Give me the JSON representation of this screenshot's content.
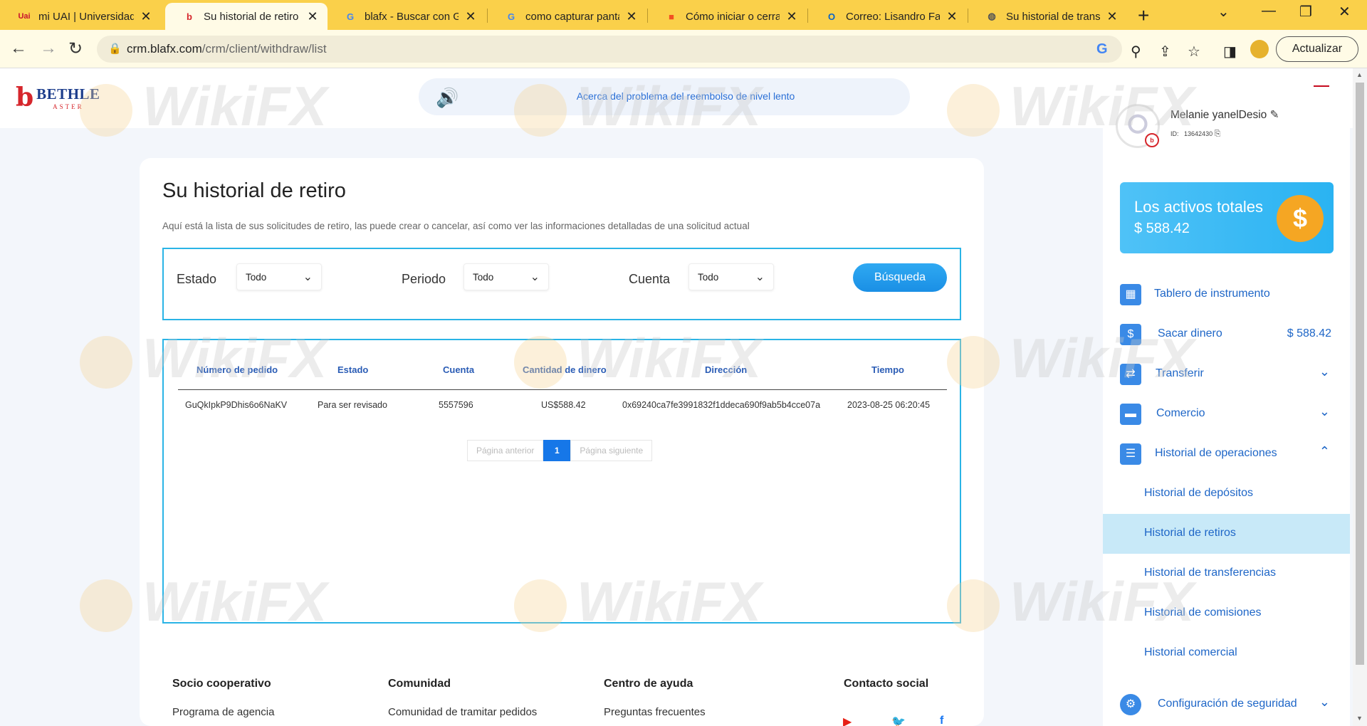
{
  "browser": {
    "tabs": [
      {
        "title": "mi UAI | Universidad A",
        "favicon": "Uai",
        "favicon_color": "#c8102e"
      },
      {
        "title": "Su historial de retiro",
        "favicon": "b",
        "favicon_color": "#d6262c",
        "active": true
      },
      {
        "title": "blafx - Buscar con Goo",
        "favicon": "G",
        "favicon_color": "#4285f4"
      },
      {
        "title": "como capturar pantal",
        "favicon": "G",
        "favicon_color": "#4285f4"
      },
      {
        "title": "Cómo iniciar o cerrar",
        "favicon": "■",
        "favicon_color": "#f25022"
      },
      {
        "title": "Correo: Lisandro Farir",
        "favicon": "O",
        "favicon_color": "#0a64c8"
      },
      {
        "title": "Su historial de transfe",
        "favicon": "◍",
        "favicon_color": "#555"
      }
    ],
    "url_host": "crm.blafx.com",
    "url_path": "/crm/client/withdraw/list",
    "update_label": "Actualizar"
  },
  "header": {
    "logo_main": "BETHLE",
    "logo_sub": "ASTER",
    "notice": "Acerca del problema del reembolso de nivel lento"
  },
  "main": {
    "title": "Su historial de retiro",
    "description": "Aquí está la lista de sus solicitudes de retiro, las puede crear o cancelar, así como ver las informaciones detalladas de una solicitud actual",
    "filters": {
      "estado_label": "Estado",
      "estado_value": "Todo",
      "periodo_label": "Periodo",
      "periodo_value": "Todo",
      "cuenta_label": "Cuenta",
      "cuenta_value": "Todo",
      "search_label": "Búsqueda"
    },
    "table": {
      "headers": [
        "Número de pedido",
        "Estado",
        "Cuenta",
        "Cantidad de dinero",
        "Dirección",
        "Tiempo"
      ],
      "rows": [
        [
          "GuQkIpkP9Dhis6o6NaKV",
          "Para ser revisado",
          "5557596",
          "US$588.42",
          "0x69240ca7fe3991832f1ddeca690f9ab5b4cce07a",
          "2023-08-25 06:20:45"
        ]
      ]
    },
    "pager": {
      "prev": "Página anterior",
      "current": "1",
      "next": "Página siguiente"
    }
  },
  "footer": {
    "cols": [
      {
        "heading": "Socio cooperativo",
        "link": "Programa de agencia"
      },
      {
        "heading": "Comunidad",
        "link": "Comunidad de tramitar pedidos"
      },
      {
        "heading": "Centro de ayuda",
        "link": "Preguntas frecuentes"
      },
      {
        "heading": "Contacto social",
        "link": ""
      }
    ]
  },
  "sidebar": {
    "user_name": "Melanie yanelDesio",
    "user_id_label": "ID:",
    "user_id": "13642430",
    "assets_title": "Los activos totales",
    "assets_amount": "$ 588.42",
    "nav": {
      "dashboard": "Tablero de instrumento",
      "withdraw": "Sacar dinero",
      "withdraw_amount": "$ 588.42",
      "transfer": "Transferir",
      "commerce": "Comercio",
      "history": "Historial de operaciones",
      "sub": [
        "Historial de depósitos",
        "Historial de retiros",
        "Historial de transferencias",
        "Historial de comisiones",
        "Historial comercial"
      ],
      "security": "Configuración de seguridad"
    }
  },
  "watermark": "WikiFX"
}
